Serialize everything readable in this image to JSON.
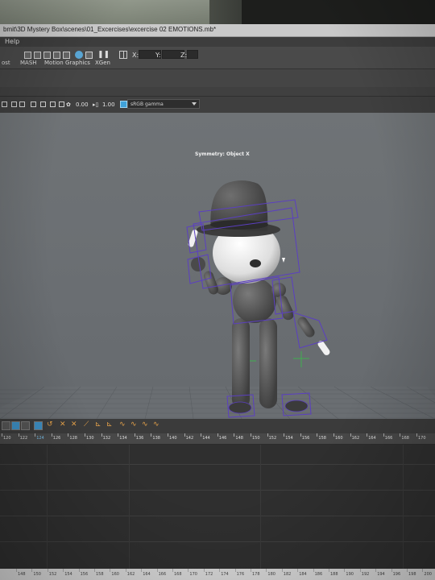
{
  "window": {
    "title": "Mystery Box\\scenes\\01_Excercises\\excercise 02 EMOTIONS.mb*",
    "title_prefix": "bmit\\3D"
  },
  "menu": {
    "help": "Help"
  },
  "shelf": {
    "tabs": [
      "ost",
      "MASH",
      "Motion Graphics",
      "XGen"
    ],
    "axis_labels": [
      "X:",
      "Y:",
      "Z:"
    ]
  },
  "panel_toolbar": {
    "exposure": "0.00",
    "gamma": "1.00",
    "color_space": "sRGB gamma"
  },
  "viewport": {
    "symmetry": "Symmetry: Object X",
    "camera": "persp",
    "background": "#6e7275",
    "selection_color": "#5b3fc2"
  },
  "timeline": {
    "ticks_top": [
      "120",
      "122",
      "124",
      "126",
      "128",
      "130",
      "132",
      "134",
      "136",
      "138",
      "140",
      "142",
      "144",
      "146",
      "148",
      "150",
      "152",
      "154",
      "156",
      "158",
      "160",
      "162",
      "164",
      "166",
      "168",
      "170"
    ],
    "ticks_bottom": [
      "148",
      "150",
      "152",
      "154",
      "156",
      "158",
      "160",
      "162",
      "164",
      "166",
      "168",
      "170",
      "172",
      "174",
      "176",
      "178",
      "180",
      "182",
      "184",
      "186",
      "188",
      "190",
      "192",
      "194",
      "196",
      "198",
      "200"
    ]
  }
}
